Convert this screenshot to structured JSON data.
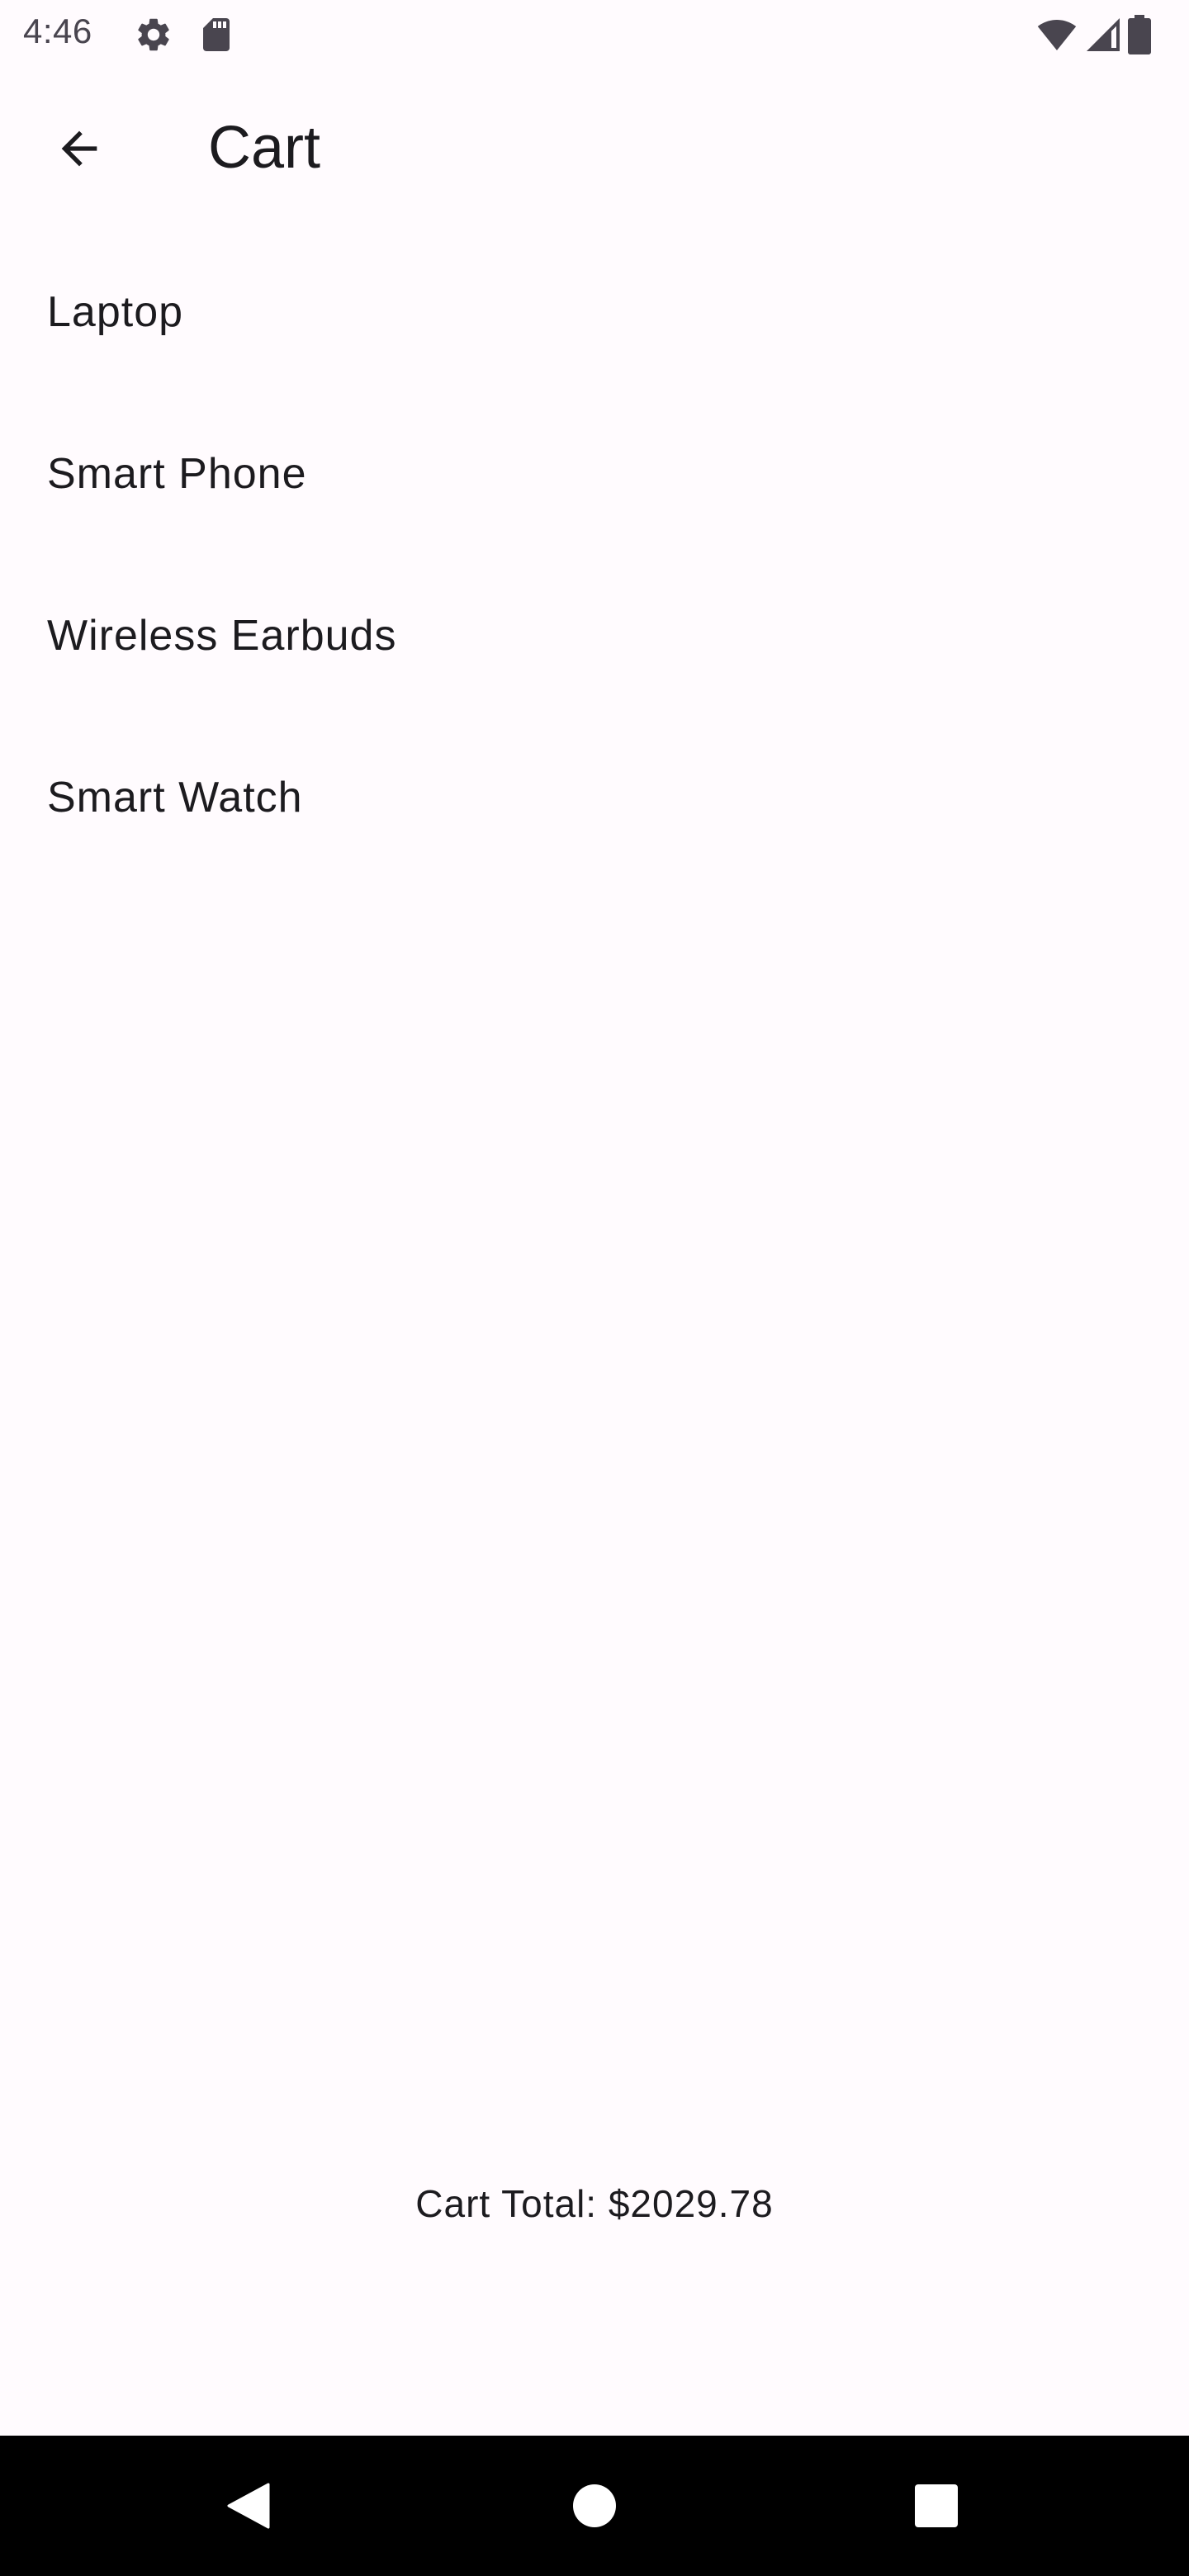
{
  "status_bar": {
    "time": "4:46",
    "icons": [
      "gear-icon",
      "sd-card-icon",
      "wifi-icon",
      "signal-icon",
      "battery-icon"
    ]
  },
  "app_bar": {
    "title": "Cart",
    "back_icon": "arrow-back-icon"
  },
  "cart": {
    "items": [
      {
        "label": "Laptop"
      },
      {
        "label": "Smart Phone"
      },
      {
        "label": "Wireless Earbuds"
      },
      {
        "label": "Smart Watch"
      }
    ],
    "total_text": "Cart Total: $2029.78"
  },
  "nav_bar": {
    "buttons": [
      "back-triangle-icon",
      "home-circle-icon",
      "recents-square-icon"
    ]
  },
  "colors": {
    "background": "#fffbfe",
    "text": "#1c1b1f",
    "status_icons": "#49454f",
    "nav_bar": "#000000"
  }
}
